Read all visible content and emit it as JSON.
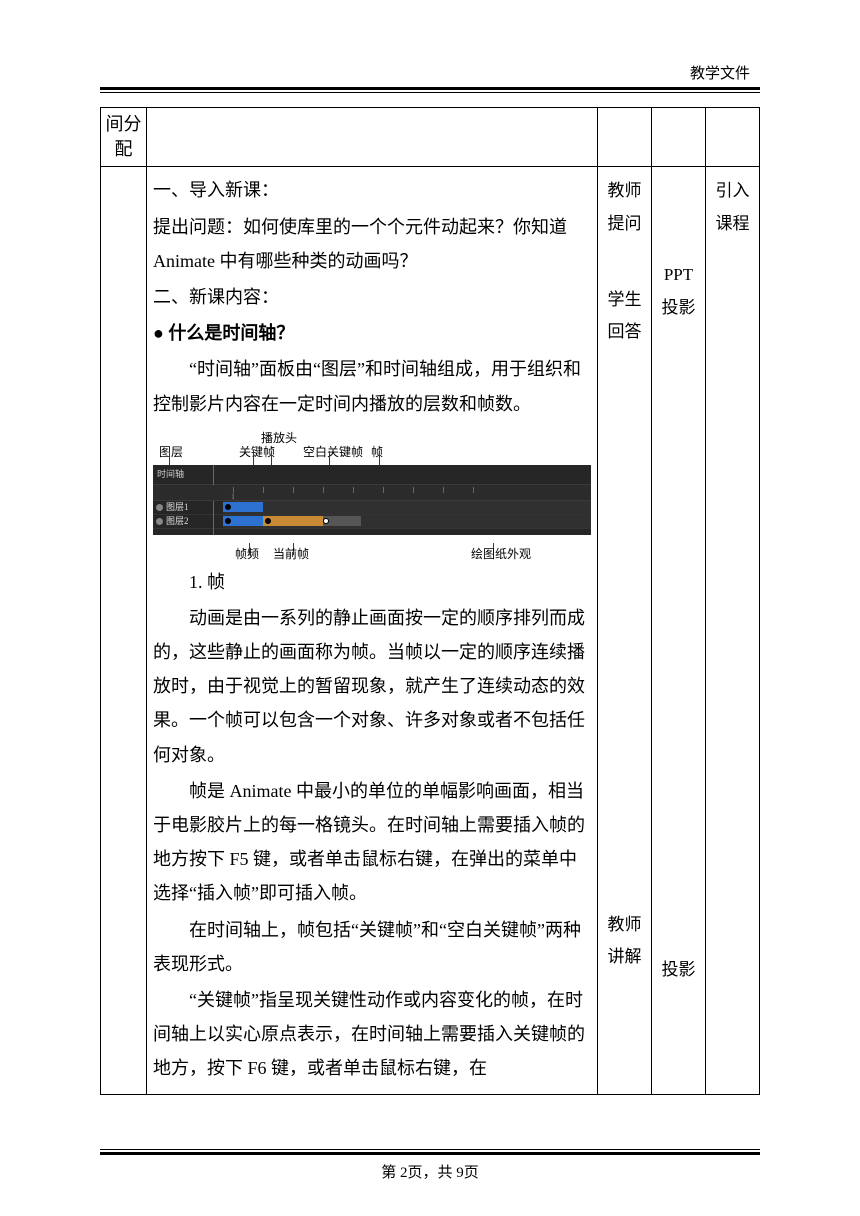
{
  "header": {
    "doc_label": "教学文件"
  },
  "table": {
    "row1_col1": "间分配",
    "side": {
      "c1a": "教师提问",
      "c1b": "学生回答",
      "c2a": "",
      "c2b": "PPT投影",
      "c3a": "引入课程",
      "c4": "教师讲解",
      "c5": "投影"
    }
  },
  "content": {
    "h1": "一、导入新课：",
    "p1": "提出问题：如何使库里的一个个元件动起来？你知道 Animate 中有哪些种类的动画吗？",
    "h2": "二、新课内容：",
    "bullet1": "● 什么是时间轴？",
    "p2": "“时间轴”面板由“图层”和时间轴组成，用于组织和控制影片内容在一定时间内播放的层数和帧数。",
    "labels": {
      "tuceng": "图层",
      "bofangtou": "播放头",
      "guanjianzhen": "关键帧",
      "kongbai": "空白关键帧",
      "zhen": "帧",
      "zhenpin": "帧频",
      "dangqian": "当前帧",
      "huitu": "绘图纸外观",
      "layer1": "图层1",
      "layer2": "图层2"
    },
    "sec1_title": "1. 帧",
    "p3": "动画是由一系列的静止画面按一定的顺序排列而成的，这些静止的画面称为帧。当帧以一定的顺序连续播放时，由于视觉上的暂留现象，就产生了连续动态的效果。一个帧可以包含一个对象、许多对象或者不包括任何对象。",
    "p4": "帧是 Animate 中最小的单位的单幅影响画面，相当于电影胶片上的每一格镜头。在时间轴上需要插入帧的地方按下 F5 键，或者单击鼠标右键，在弹出的菜单中选择“插入帧”即可插入帧。",
    "p5": "在时间轴上，帧包括“关键帧”和“空白关键帧”两种表现形式。",
    "p6": "“关键帧”指呈现关键性动作或内容变化的帧，在时间轴上以实心原点表示，在时间轴上需要插入关键帧的地方，按下 F6 键，或者单击鼠标右键，在"
  },
  "footer": {
    "page_label_pre": "第 ",
    "page_no": "2",
    "page_label_mid": "页，共 ",
    "page_total": "9",
    "page_label_post": "页"
  }
}
